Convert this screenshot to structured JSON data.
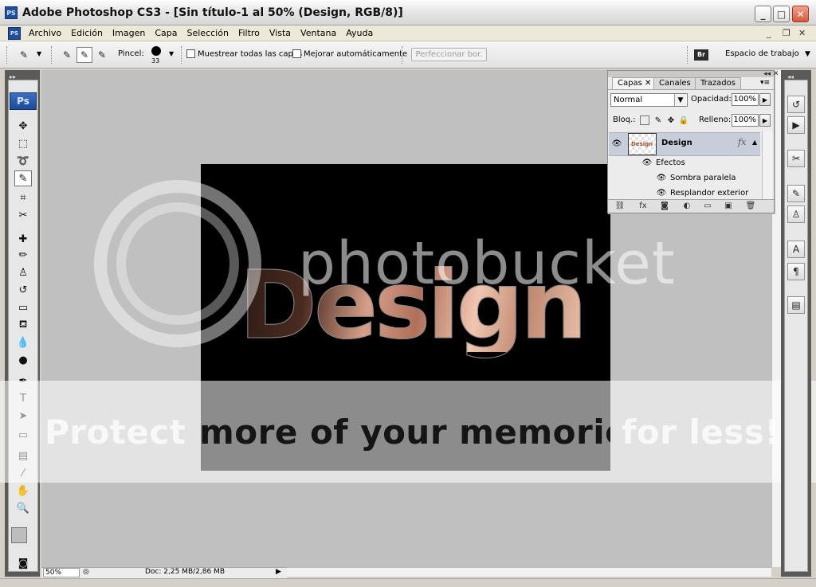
{
  "window": {
    "app_icon": "PS",
    "title": "Adobe Photoshop CS3 - [Sin título-1 al 50% (Design, RGB/8)]",
    "controls": {
      "minimize": "_",
      "maximize": "□",
      "close": "✕"
    }
  },
  "menu": {
    "app_icon": "PS",
    "items": [
      "Archivo",
      "Edición",
      "Imagen",
      "Capa",
      "Selección",
      "Filtro",
      "Vista",
      "Ventana",
      "Ayuda"
    ],
    "doc_controls": {
      "minimize": "_",
      "restore": "❐",
      "close": "✕"
    }
  },
  "options": {
    "brush_label": "Pincel:",
    "brush_size": "33",
    "sample_all_label": "Muestrear todas las capas",
    "auto_enhance_label": "Mejorar automáticamente",
    "refine_edge_label": "Perfeccionar bor.",
    "bridge_icon": "Br",
    "workspace_label": "Espacio de trabajo"
  },
  "tools": {
    "logo": "Ps",
    "items": [
      {
        "name": "move-tool-icon",
        "glyph": "✥"
      },
      {
        "name": "marquee-tool-icon",
        "glyph": "⬚"
      },
      {
        "name": "lasso-tool-icon",
        "glyph": "➰"
      },
      {
        "name": "quick-selection-tool-icon",
        "glyph": "✎"
      },
      {
        "name": "crop-tool-icon",
        "glyph": "⌗"
      },
      {
        "name": "slice-tool-icon",
        "glyph": "✂"
      },
      {
        "name": "healing-brush-icon",
        "glyph": "✚"
      },
      {
        "name": "brush-tool-icon",
        "glyph": "✏"
      },
      {
        "name": "clone-stamp-icon",
        "glyph": "♙"
      },
      {
        "name": "history-brush-icon",
        "glyph": "↺"
      },
      {
        "name": "eraser-tool-icon",
        "glyph": "▭"
      },
      {
        "name": "paint-bucket-icon",
        "glyph": "⛾"
      },
      {
        "name": "blur-tool-icon",
        "glyph": "💧"
      },
      {
        "name": "dodge-tool-icon",
        "glyph": "●"
      },
      {
        "name": "pen-tool-icon",
        "glyph": "✒"
      },
      {
        "name": "type-tool-icon",
        "glyph": "T"
      },
      {
        "name": "path-selection-icon",
        "glyph": "➤"
      },
      {
        "name": "shape-tool-icon",
        "glyph": "▭"
      },
      {
        "name": "notes-tool-icon",
        "glyph": "▤"
      },
      {
        "name": "eyedropper-icon",
        "glyph": "⁄"
      },
      {
        "name": "hand-tool-icon",
        "glyph": "✋"
      },
      {
        "name": "zoom-tool-icon",
        "glyph": "🔍"
      }
    ]
  },
  "canvas": {
    "text": "Design"
  },
  "watermark": {
    "logo": "photobucket",
    "tagline_light": "Protect",
    "tagline_dark": "more of your memories",
    "tagline_end": "for less!"
  },
  "status": {
    "zoom": "50%",
    "doc_info": "Doc: 2,25 MB/2,86 MB"
  },
  "layers_panel": {
    "tabs": [
      "Capas",
      "Canales",
      "Trazados"
    ],
    "blend_mode": "Normal",
    "opacity_label": "Opacidad:",
    "opacity_value": "100%",
    "lock_label": "Bloq.:",
    "fill_label": "Relleno:",
    "fill_value": "100%",
    "layer_name": "Design",
    "thumb_text": "Design",
    "fx_label": "fx",
    "effects_label": "Efectos",
    "effects": [
      "Sombra paralela",
      "Resplandor exterior"
    ]
  },
  "dock": {
    "buttons": [
      "history-icon",
      "actions-icon",
      "tool-presets-icon",
      "brushes-icon",
      "clone-source-icon",
      "character-icon",
      "paragraph-icon",
      "layer-comps-icon"
    ]
  }
}
